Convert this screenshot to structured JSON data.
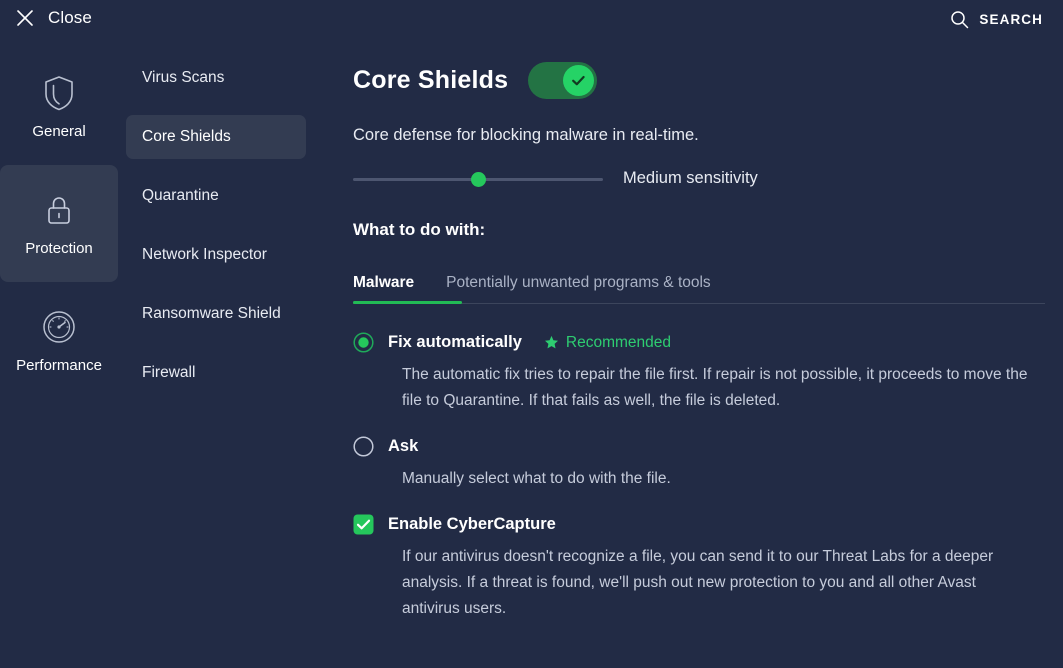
{
  "topbar": {
    "close_label": "Close",
    "close_icon": "close-x-icon",
    "search_label": "SEARCH",
    "search_icon": "search-magnifier-icon"
  },
  "rail": {
    "items": [
      {
        "label": "General",
        "icon": "shield-icon",
        "active": false
      },
      {
        "label": "Protection",
        "icon": "lock-icon",
        "active": true
      },
      {
        "label": "Performance",
        "icon": "gauge-icon",
        "active": false
      }
    ]
  },
  "subnav": {
    "items": [
      {
        "label": "Virus Scans",
        "active": false
      },
      {
        "label": "Core Shields",
        "active": true
      },
      {
        "label": "Quarantine",
        "active": false
      },
      {
        "label": "Network Inspector",
        "active": false
      },
      {
        "label": "Ransomware Shield",
        "active": false
      },
      {
        "label": "Firewall",
        "active": false
      }
    ]
  },
  "main": {
    "title": "Core Shields",
    "toggle": {
      "state": "on",
      "icon": "check-icon"
    },
    "subtitle": "Core defense for blocking malware in real-time.",
    "slider": {
      "value_label": "Medium sensitivity",
      "percent": 50
    },
    "section_heading": "What to do with:",
    "tabs": [
      {
        "label": "Malware",
        "active": true
      },
      {
        "label": "Potentially unwanted programs & tools",
        "active": false
      }
    ],
    "options": [
      {
        "type": "radio",
        "selected": true,
        "label": "Fix automatically",
        "badge": "Recommended",
        "badge_icon": "star-icon",
        "description": "The automatic fix tries to repair the file first. If repair is not possible, it proceeds to move the file to Quarantine. If that fails as well, the file is deleted."
      },
      {
        "type": "radio",
        "selected": false,
        "label": "Ask",
        "description": "Manually select what to do with the file."
      },
      {
        "type": "checkbox",
        "selected": true,
        "label": "Enable CyberCapture",
        "description": "If our antivirus doesn't recognize a file, you can send it to our Threat Labs for a deeper analysis. If a threat is found, we'll push out new protection to you and all other Avast antivirus users."
      }
    ]
  },
  "colors": {
    "background": "#222b45",
    "panel_active": "#333c52",
    "accent_green": "#25d366",
    "toggle_track": "#237344",
    "text_primary": "#ffffff",
    "text_secondary": "#c6ccdb"
  }
}
